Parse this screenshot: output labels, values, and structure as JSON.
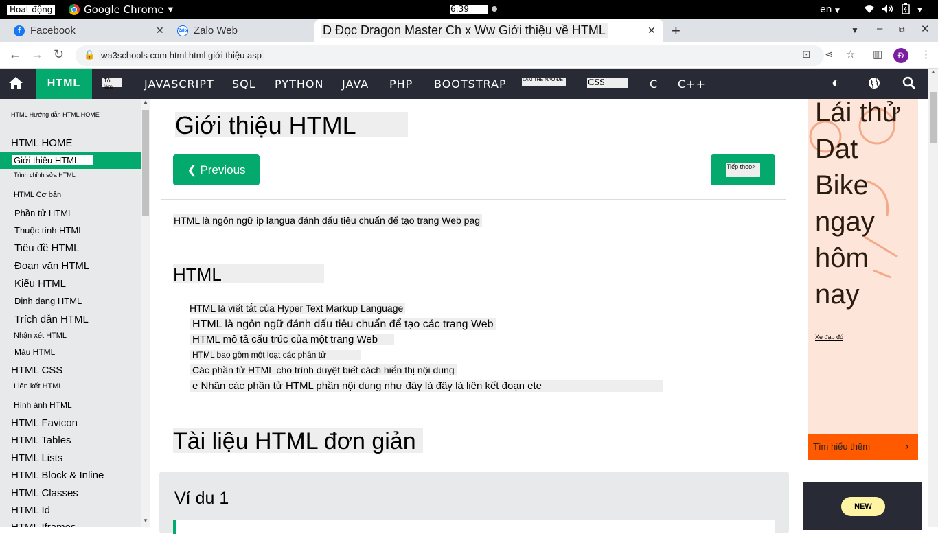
{
  "os": {
    "activities": "Hoạt động",
    "app_name": "Google Chrome",
    "clock": "6:39",
    "language": "en"
  },
  "tabs": [
    {
      "label": "Facebook",
      "favicon": "facebook-icon"
    },
    {
      "label": "Zalo Web",
      "favicon": "zalo-icon"
    },
    {
      "label": "D Đọc Dragon Master Ch x Ww Giới thiệu về HTML",
      "favicon": "none"
    }
  ],
  "address": {
    "url": "wa3schools com html html giới thiệu asp"
  },
  "profile_initial": "Đ",
  "w3nav": {
    "html": "HTML",
    "small_left": "Tôi làm",
    "items": [
      "JAVASCRIPT",
      "SQL",
      "PYTHON",
      "JAVA",
      "PHP",
      "BOOTSTRAP"
    ],
    "small_mid": "LÀM THẾ NÀO ĐỂ",
    "css": "CSS",
    "c": "C",
    "cpp": "C++"
  },
  "sidebar": {
    "items": [
      {
        "label": "HTML Hướng dẫn HTML HOME"
      },
      {
        "label": "HTML HOME"
      },
      {
        "label": "Giới thiệu HTML"
      },
      {
        "label": "Trình chỉnh sửa HTML"
      },
      {
        "label": "HTML Cơ bản"
      },
      {
        "label": "Phần tử HTML"
      },
      {
        "label": "Thuộc tính HTML"
      },
      {
        "label": "Tiêu đề HTML"
      },
      {
        "label": "Đoạn văn HTML"
      },
      {
        "label": "Kiểu HTML"
      },
      {
        "label": "Định dạng HTML"
      },
      {
        "label": "Trích dẫn HTML"
      },
      {
        "label": "Nhận xét HTML"
      },
      {
        "label": "Màu HTML"
      },
      {
        "label": "HTML CSS"
      },
      {
        "label": "Liên kết HTML"
      },
      {
        "label": "Hình ảnh HTML"
      },
      {
        "label": "HTML Favicon"
      },
      {
        "label": "HTML Tables"
      },
      {
        "label": "HTML Lists"
      },
      {
        "label": "HTML Block & Inline"
      },
      {
        "label": "HTML Classes"
      },
      {
        "label": "HTML Id"
      },
      {
        "label": "HTML Iframes"
      }
    ]
  },
  "main": {
    "title": "Giới thiệu HTML",
    "prev": "❮ Previous",
    "next": "Tiếp theo>",
    "intro": "HTML là ngôn ngữ ip langua đánh dấu tiêu chuẩn để tạo trang Web pag",
    "h2": "HTML",
    "bullets": [
      "HTML là viết tắt của Hyper Text Markup Language",
      "HTML là ngôn ngữ đánh dấu tiêu chuẩn để tạo các trang Web",
      "HTML mô tả cấu trúc của một trang Web",
      "HTML bao gồm một loạt các phần tử",
      "Các phần tử HTML cho trình duyệt biết cách hiển thị nội dung",
      "e Nhãn các phần tử HTML phần nội dung như đây là đây là liên kết đoạn ete"
    ],
    "h2b": "Tài liệu HTML đơn giản",
    "example_title": "Ví du 1"
  },
  "ad": {
    "text": "Lái thử Dat Bike ngay hôm nay",
    "small": "Xe đạp đó",
    "cta": "Tìm hiểu thêm",
    "new": "NEW"
  }
}
